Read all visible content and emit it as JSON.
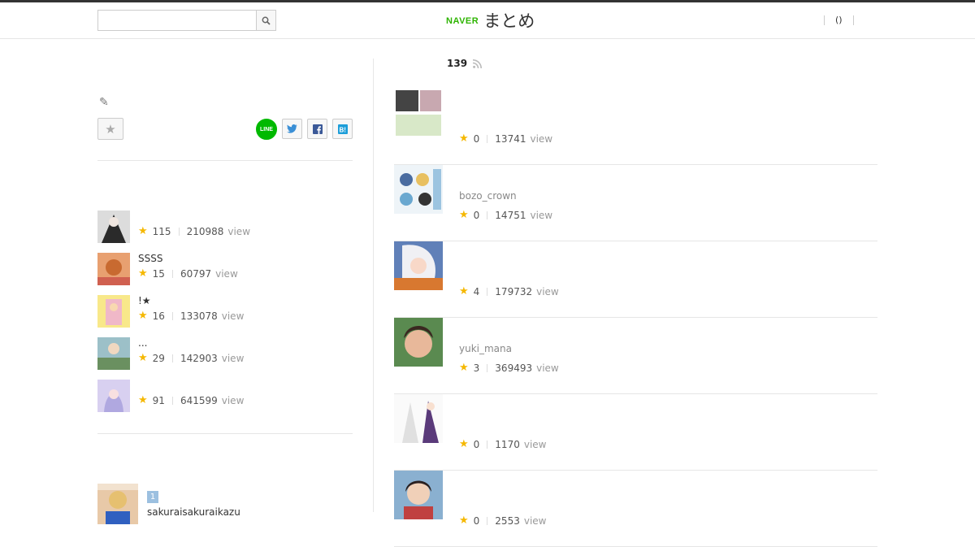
{
  "header": {
    "search_placeholder": "",
    "logo_brand": "NAVER",
    "logo_text": "まとめ",
    "nav_item": "()"
  },
  "left": {
    "edit_icon": "pencil-icon",
    "favorite_icon": "star-icon",
    "share_line": "LINE",
    "share_icons": [
      "line-icon",
      "twitter-icon",
      "facebook-icon",
      "hatena-bookmark-icon"
    ],
    "related": [
      {
        "title": "",
        "favorites": "115",
        "views": "210988",
        "view_label": "view"
      },
      {
        "title": "SSSS",
        "favorites": "15",
        "views": "60797",
        "view_label": "view"
      },
      {
        "title": "!★",
        "favorites": "16",
        "views": "133078",
        "view_label": "view"
      },
      {
        "title": "...",
        "favorites": "29",
        "views": "142903",
        "view_label": "view"
      },
      {
        "title": "",
        "favorites": "91",
        "views": "641599",
        "view_label": "view"
      }
    ],
    "ranking": {
      "rank": "1",
      "name": "sakuraisakuraikazu"
    }
  },
  "right": {
    "count": "139",
    "items": [
      {
        "author": "",
        "favorites": "0",
        "views": "13741",
        "view_label": "view"
      },
      {
        "author": "bozo_crown",
        "favorites": "0",
        "views": "14751",
        "view_label": "view"
      },
      {
        "author": "",
        "favorites": "4",
        "views": "179732",
        "view_label": "view"
      },
      {
        "author": "yuki_mana",
        "favorites": "3",
        "views": "369493",
        "view_label": "view"
      },
      {
        "author": "",
        "favorites": "0",
        "views": "1170",
        "view_label": "view"
      },
      {
        "author": "",
        "favorites": "0",
        "views": "2553",
        "view_label": "view"
      }
    ]
  },
  "colors": {
    "brand_green": "#2db400",
    "star": "#f5b800",
    "line_green": "#00b900"
  }
}
